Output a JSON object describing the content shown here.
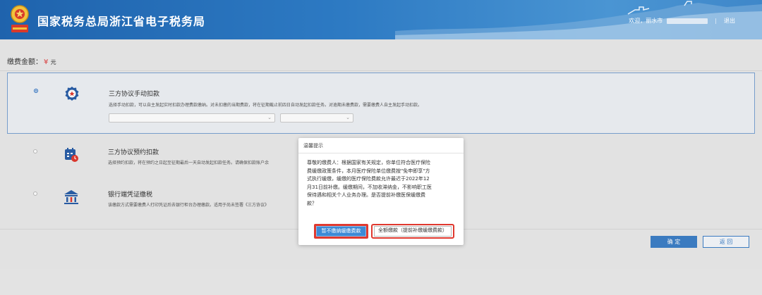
{
  "header": {
    "title": "国家税务总局浙江省电子税务局",
    "welcome": "欢迎，丽水市",
    "separator": "|",
    "logout": "退出",
    "bg_color": "#2d7ac3"
  },
  "payment": {
    "label": "缴费金额：",
    "currency": "¥",
    "unit": "元"
  },
  "options": [
    {
      "title": "三方协议手动扣款",
      "desc": "选择手动扣款，可以自主发起实时扣款办理费款缴纳。对未扣缴的当期费款，将在征期截止前四日自动发起扣款任务。对逾期未缴费款，需要缴费人自主发起手动扣款。",
      "icon": "award-badge-icon",
      "selected": true
    },
    {
      "title": "三方协议预约扣款",
      "desc": "选择预约扣款，将在预约之日起至征期最后一天自动发起扣款任务。请确保扣款账户余",
      "icon": "calendar-clock-icon",
      "selected": false
    },
    {
      "title": "银行端凭证缴税",
      "desc": "该缴款方式需要缴费人打印凭证后去银行柜台办理缴款。适用于尚未签署《三方协议》",
      "icon": "bank-icon",
      "selected": false
    }
  ],
  "footer": {
    "confirm": "确 定",
    "back": "返 回"
  },
  "modal": {
    "title": "温馨提示",
    "lines": [
      "尊敬的缴费人：根据国家有关规定，你单位符合医疗保险",
      "费缓缴政策条件，本月医疗保险单位缴费按\"免申即享\"方",
      "式执行缓缴，缓缴的医疗保险费款允许最迟于2022年12",
      "月31日前补缴。缓缴期间，不加收滞纳金，不影响职工医",
      "保待遇和相关个人业务办理。是否提前补缴医保缓缴费",
      "款？"
    ],
    "btn_primary": "暂不缴纳缓缴费款",
    "btn_secondary": "全额缴款（提前补缴缓缴费款）"
  }
}
